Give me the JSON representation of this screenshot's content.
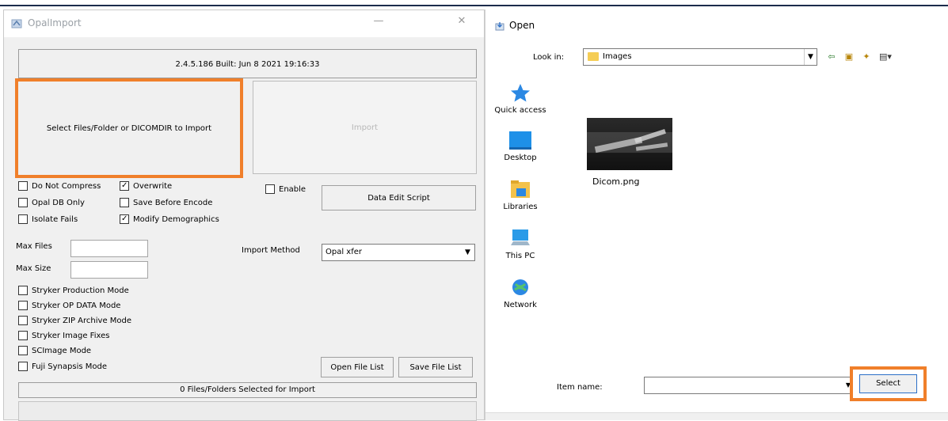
{
  "left_window": {
    "title": "OpalImport",
    "version": "2.4.5.186  Built: Jun  8 2021 19:16:33",
    "select_label": "Select Files/Folder or DICOMDIR to Import",
    "import_label": "Import",
    "options": {
      "do_not_compress": {
        "label": "Do Not Compress",
        "checked": false
      },
      "overwrite": {
        "label": "Overwrite",
        "checked": true
      },
      "enable": {
        "label": "Enable",
        "checked": false
      },
      "opal_db_only": {
        "label": "Opal DB Only",
        "checked": false
      },
      "save_before_encode": {
        "label": "Save Before Encode",
        "checked": false
      },
      "isolate_fails": {
        "label": "Isolate Fails",
        "checked": false
      },
      "modify_demographics": {
        "label": "Modify Demographics",
        "checked": true
      }
    },
    "data_edit_script_label": "Data Edit Script",
    "max_files_label": "Max Files",
    "max_size_label": "Max Size",
    "import_method_label": "Import Method",
    "import_method_value": "Opal xfer",
    "modes": [
      {
        "label": "Stryker Production Mode",
        "checked": false
      },
      {
        "label": "Stryker OP DATA Mode",
        "checked": false
      },
      {
        "label": "Stryker ZIP Archive Mode",
        "checked": false
      },
      {
        "label": "Stryker Image Fixes",
        "checked": false
      },
      {
        "label": "SCImage Mode",
        "checked": false
      },
      {
        "label": "Fuji Synapsis Mode",
        "checked": false
      }
    ],
    "open_file_list_label": "Open File List",
    "save_file_list_label": "Save File List",
    "status": "0 Files/Folders Selected for Import"
  },
  "open_dialog": {
    "title": "Open",
    "look_in_label": "Look in:",
    "look_in_value": "Images",
    "places": [
      {
        "label": "Quick access",
        "icon": "star-icon"
      },
      {
        "label": "Desktop",
        "icon": "desktop-icon"
      },
      {
        "label": "Libraries",
        "icon": "libraries-icon"
      },
      {
        "label": "This PC",
        "icon": "computer-icon"
      },
      {
        "label": "Network",
        "icon": "network-icon"
      }
    ],
    "file_name": "Dicom.png",
    "item_name_label": "Item name:",
    "item_name_value": "",
    "select_label": "Select"
  },
  "colors": {
    "highlight": "#f07f2a",
    "accent": "#2b6fc7"
  }
}
